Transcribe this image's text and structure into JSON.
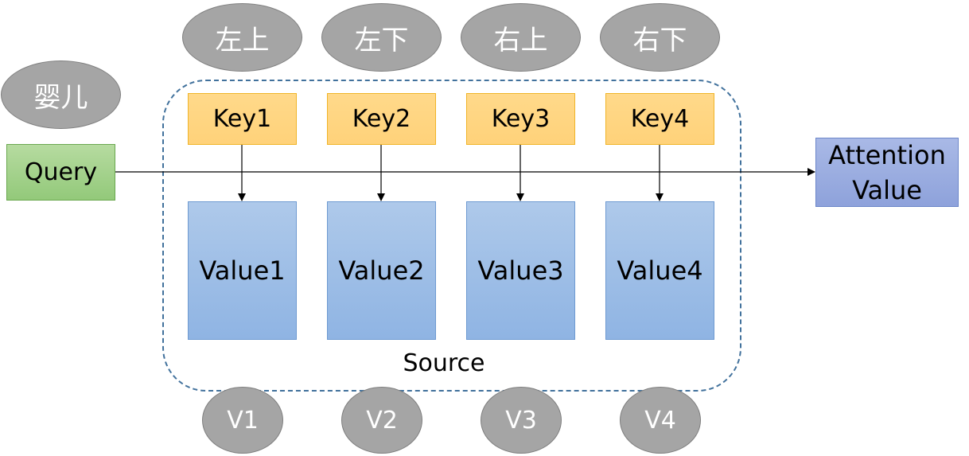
{
  "direction_labels": [
    "左上",
    "左下",
    "右上",
    "右下"
  ],
  "query_tag": "婴儿",
  "query": "Query",
  "keys": [
    "Key1",
    "Key2",
    "Key3",
    "Key4"
  ],
  "values": [
    "Value1",
    "Value2",
    "Value3",
    "Value4"
  ],
  "source_label": "Source",
  "output": {
    "line1": "Attention",
    "line2": "Value"
  },
  "weights": [
    "V1",
    "V2",
    "V3",
    "V4"
  ],
  "colors": {
    "oval_fill": "#a5a5a5",
    "key_fill": "#ffd98a",
    "value_fill": "#9dbde6",
    "query_fill": "#a9d18e",
    "attention_fill": "#9aaee0",
    "source_border": "#41719c"
  }
}
